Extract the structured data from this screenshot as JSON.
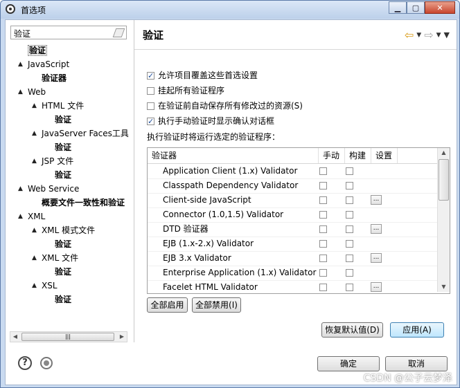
{
  "window": {
    "title": "首选项"
  },
  "filter": {
    "value": "验证"
  },
  "tree": [
    {
      "label": "验证",
      "bold": true,
      "selected": true,
      "twisty": ""
    },
    {
      "label": "JavaScript",
      "bold": false,
      "twisty": "▲"
    },
    {
      "label": "验证器",
      "bold": true,
      "twisty": ""
    },
    {
      "label": "Web",
      "bold": false,
      "twisty": "▲"
    },
    {
      "label": "HTML 文件",
      "bold": false,
      "twisty": "▲"
    },
    {
      "label": "验证",
      "bold": true,
      "twisty": ""
    },
    {
      "label": "JavaServer Faces工具",
      "bold": false,
      "twisty": "▲"
    },
    {
      "label": "验证",
      "bold": true,
      "twisty": ""
    },
    {
      "label": "JSP 文件",
      "bold": false,
      "twisty": "▲"
    },
    {
      "label": "验证",
      "bold": true,
      "twisty": ""
    },
    {
      "label": "Web Service",
      "bold": false,
      "twisty": "▲"
    },
    {
      "label": "概要文件一致性和验证",
      "bold": true,
      "twisty": ""
    },
    {
      "label": "XML",
      "bold": false,
      "twisty": "▲"
    },
    {
      "label": "XML 模式文件",
      "bold": false,
      "twisty": "▲"
    },
    {
      "label": "验证",
      "bold": true,
      "twisty": ""
    },
    {
      "label": "XML 文件",
      "bold": false,
      "twisty": "▲"
    },
    {
      "label": "验证",
      "bold": true,
      "twisty": ""
    },
    {
      "label": "XSL",
      "bold": false,
      "twisty": "▲"
    },
    {
      "label": "验证",
      "bold": true,
      "twisty": ""
    }
  ],
  "page": {
    "title": "验证",
    "options": [
      {
        "label": "允许项目覆盖这些首选设置",
        "checked": true
      },
      {
        "label": "挂起所有验证程序",
        "checked": false
      },
      {
        "label": "在验证前自动保存所有修改过的资源(S)",
        "checked": false
      },
      {
        "label": "执行手动验证时显示确认对话框",
        "checked": true
      }
    ],
    "table_caption": "执行验证时将运行选定的验证程序：",
    "columns": [
      "验证器",
      "手动",
      "构建",
      "设置"
    ],
    "validators": [
      {
        "name": "Application Client (1.x) Validator",
        "settings": false
      },
      {
        "name": "Classpath Dependency Validator",
        "settings": false
      },
      {
        "name": "Client-side JavaScript",
        "settings": true
      },
      {
        "name": "Connector (1.0,1.5) Validator",
        "settings": false
      },
      {
        "name": "DTD 验证器",
        "settings": true
      },
      {
        "name": "EJB (1.x-2.x) Validator",
        "settings": false
      },
      {
        "name": "EJB 3.x Validator",
        "settings": true
      },
      {
        "name": "Enterprise Application (1.x) Validator",
        "settings": false
      },
      {
        "name": "Facelet HTML Validator",
        "settings": true
      }
    ],
    "settings_button": "...",
    "enable_all": "全部启用",
    "disable_all": "全部禁用(I)",
    "restore_defaults": "恢复默认值(D)",
    "apply": "应用(A)"
  },
  "footer": {
    "ok": "确定",
    "cancel": "取消"
  },
  "watermark": "CSDN @公子云梦泽"
}
